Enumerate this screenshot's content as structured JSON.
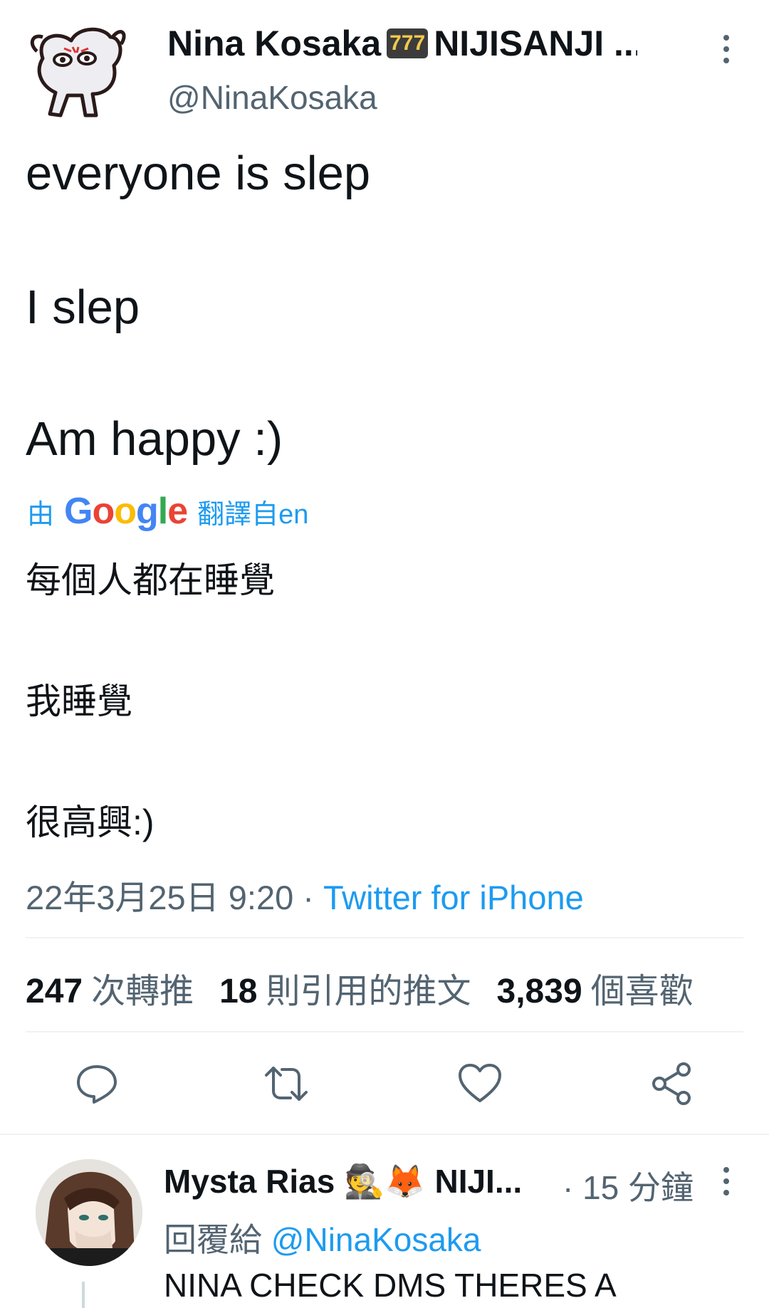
{
  "tweet": {
    "display_name": "Nina Kosaka",
    "display_name_emoji": "777",
    "display_name_suffix": "NIJISANJI ...",
    "handle": "@NinaKosaka",
    "lines": [
      "everyone is slep",
      "I slep",
      "Am happy :)"
    ],
    "translation": {
      "prefix": "由",
      "provider": "Google",
      "suffix": "翻譯自en",
      "lines": [
        "每個人都在睡覺",
        "我睡覺",
        "很高興:)"
      ]
    },
    "timestamp": "22年3月25日 9:20",
    "separator": "·",
    "source": "Twitter for iPhone",
    "stats": {
      "retweets": "247",
      "retweets_label": "次轉推",
      "quotes": "18",
      "quotes_label": "則引用的推文",
      "likes": "3,839",
      "likes_label": "個喜歡"
    }
  },
  "reply": {
    "display_name": "Mysta Rias",
    "display_name_suffix": "NIJI...",
    "time": "· 15 分鐘",
    "reply_to_label": "回覆給",
    "reply_to_handle": "@NinaKosaka",
    "text": "NINA CHECK DMS THERES A"
  },
  "colors": {
    "accent": "#1d9bf0",
    "secondary_text": "#536471",
    "primary_text": "#0f1419",
    "divider": "#eff3f4"
  },
  "icons": [
    "more-vertical-icon",
    "reply-icon",
    "retweet-icon",
    "like-icon",
    "share-icon"
  ]
}
